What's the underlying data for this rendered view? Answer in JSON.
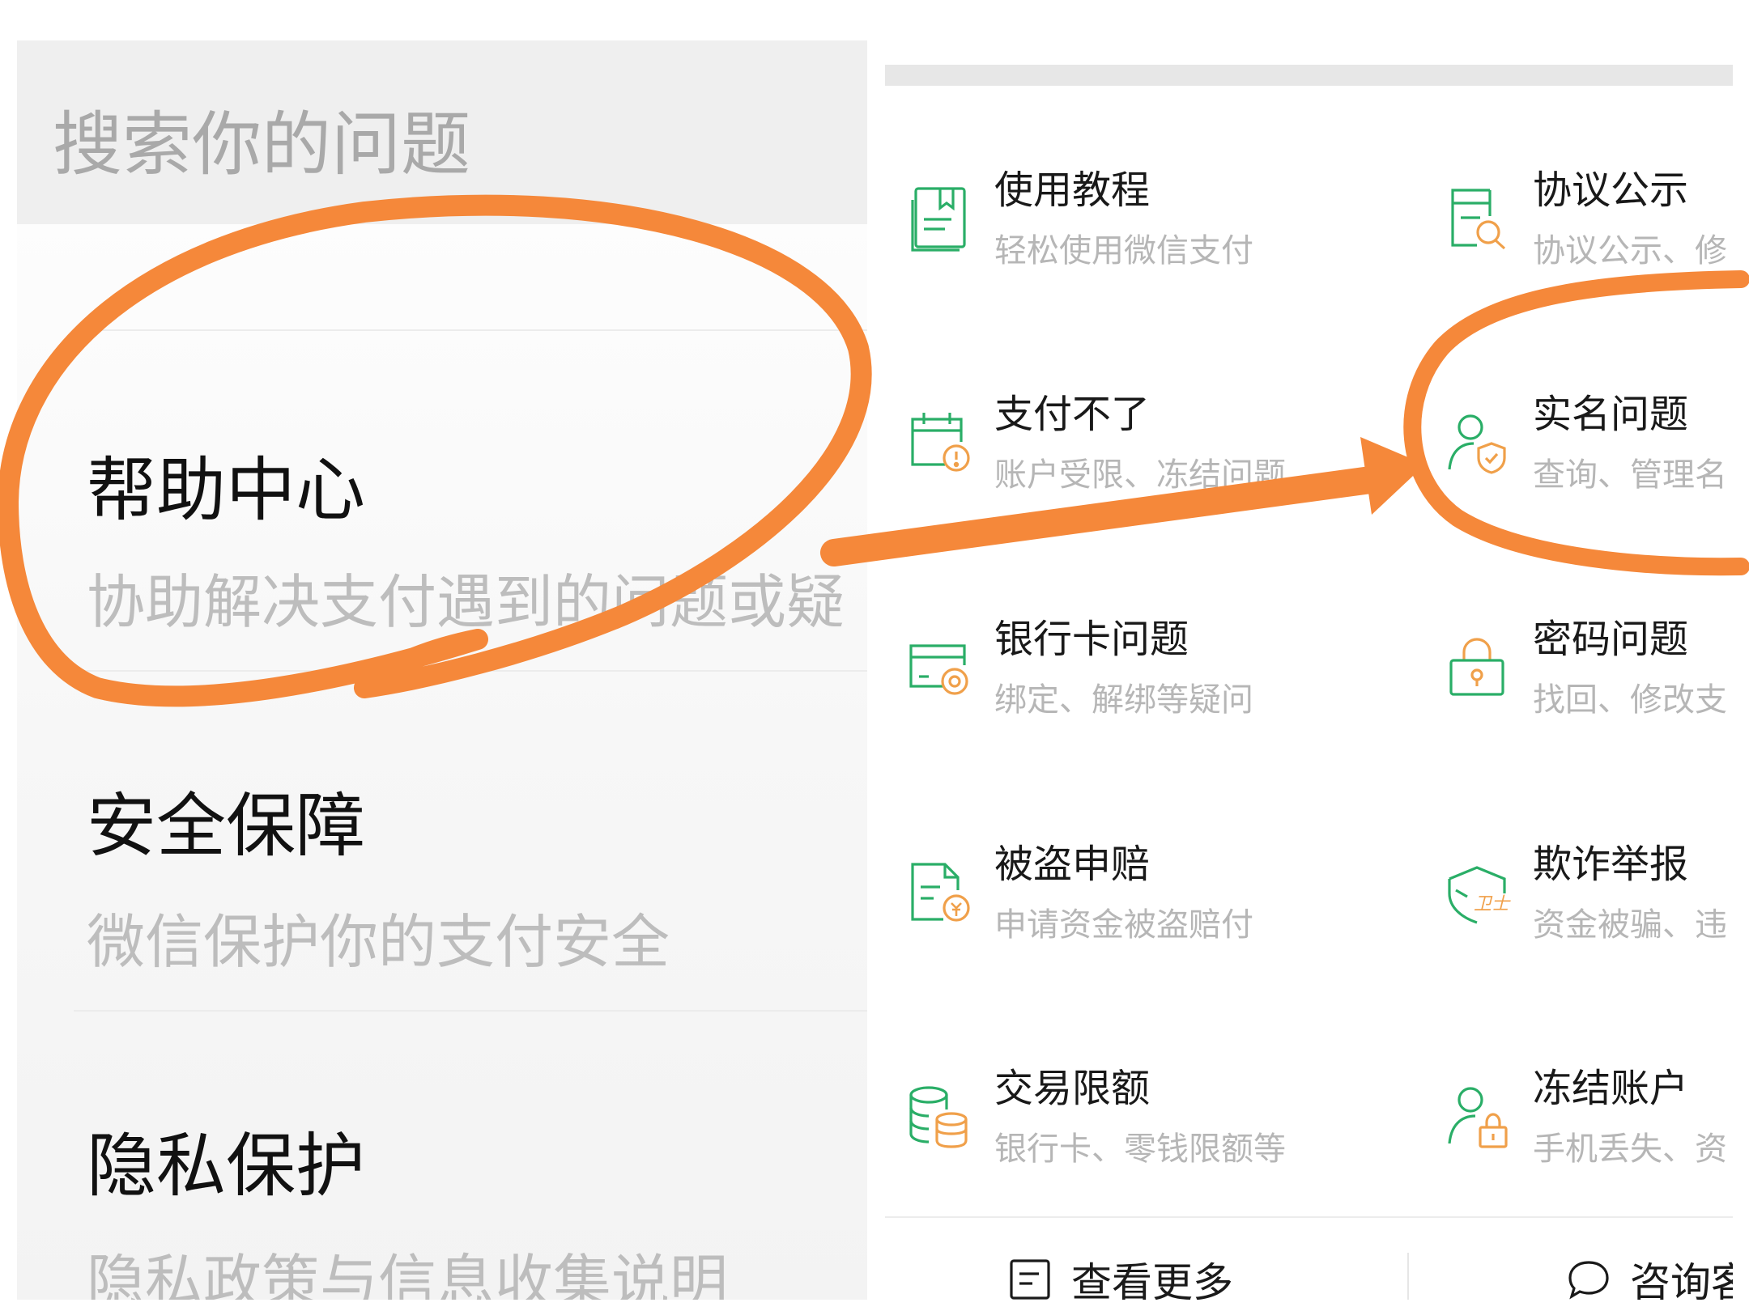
{
  "left_panel": {
    "search_placeholder": "搜索你的问题",
    "items": [
      {
        "title": "帮助中心",
        "subtitle": "协助解决支付遇到的问题或疑"
      },
      {
        "title": "安全保障",
        "subtitle": "微信保护你的支付安全"
      },
      {
        "title": "隐私保护",
        "subtitle": "隐私政策与信息收集说明"
      }
    ]
  },
  "right_panel": {
    "tiles": [
      {
        "title": "使用教程",
        "subtitle": "轻松使用微信支付",
        "icon": "book-icon"
      },
      {
        "title": "协议公示",
        "subtitle": "协议公示、修",
        "icon": "document-search-icon"
      },
      {
        "title": "支付不了",
        "subtitle": "账户受限、冻结问题",
        "icon": "calendar-alert-icon"
      },
      {
        "title": "实名问题",
        "subtitle": "查询、管理名",
        "icon": "user-shield-icon"
      },
      {
        "title": "银行卡问题",
        "subtitle": "绑定、解绑等疑问",
        "icon": "bank-card-icon"
      },
      {
        "title": "密码问题",
        "subtitle": "找回、修改支",
        "icon": "lock-icon"
      },
      {
        "title": "被盗申赔",
        "subtitle": "申请资金被盗赔付",
        "icon": "claim-document-icon"
      },
      {
        "title": "欺诈举报",
        "subtitle": "资金被骗、违",
        "icon": "guard-shield-icon"
      },
      {
        "title": "交易限额",
        "subtitle": "银行卡、零钱限额等",
        "icon": "coin-stack-icon"
      },
      {
        "title": "冻结账户",
        "subtitle": "手机丢失、资",
        "icon": "user-lock-icon"
      }
    ],
    "bottom_actions": [
      {
        "label": "查看更多",
        "icon": "list-icon"
      },
      {
        "label": "咨询客",
        "icon": "chat-icon"
      }
    ],
    "guard_badge_text": "卫士"
  },
  "colors": {
    "icon_green": "#2aae67",
    "icon_orange": "#f0a04a",
    "annotation_orange": "#f5883a"
  }
}
